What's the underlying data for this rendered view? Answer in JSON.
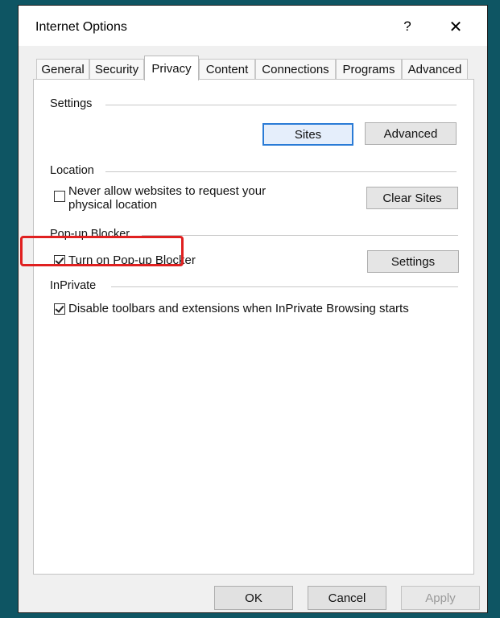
{
  "window": {
    "title": "Internet Options",
    "help_label": "?",
    "close_label": "✕"
  },
  "tabs": [
    {
      "label": "General"
    },
    {
      "label": "Security"
    },
    {
      "label": "Privacy"
    },
    {
      "label": "Content"
    },
    {
      "label": "Connections"
    },
    {
      "label": "Programs"
    },
    {
      "label": "Advanced"
    }
  ],
  "active_tab": "Privacy",
  "settings": {
    "heading": "Settings",
    "sites_button": "Sites",
    "advanced_button": "Advanced"
  },
  "location": {
    "heading": "Location",
    "checkbox_label_line1": "Never allow websites to request your",
    "checkbox_label_line2": "physical location",
    "checked": false,
    "clear_sites_button": "Clear Sites"
  },
  "popup_blocker": {
    "heading": "Pop-up Blocker",
    "checkbox_label": "Turn on Pop-up Blocker",
    "checked": true,
    "settings_button": "Settings"
  },
  "inprivate": {
    "heading": "InPrivate",
    "checkbox_label": "Disable toolbars and extensions when InPrivate Browsing starts",
    "checked": true
  },
  "footer": {
    "ok_button": "OK",
    "cancel_button": "Cancel",
    "apply_button": "Apply"
  },
  "colors": {
    "desktop": "#0e5563",
    "highlight": "#e02020",
    "focus": "#2a7bd6"
  }
}
